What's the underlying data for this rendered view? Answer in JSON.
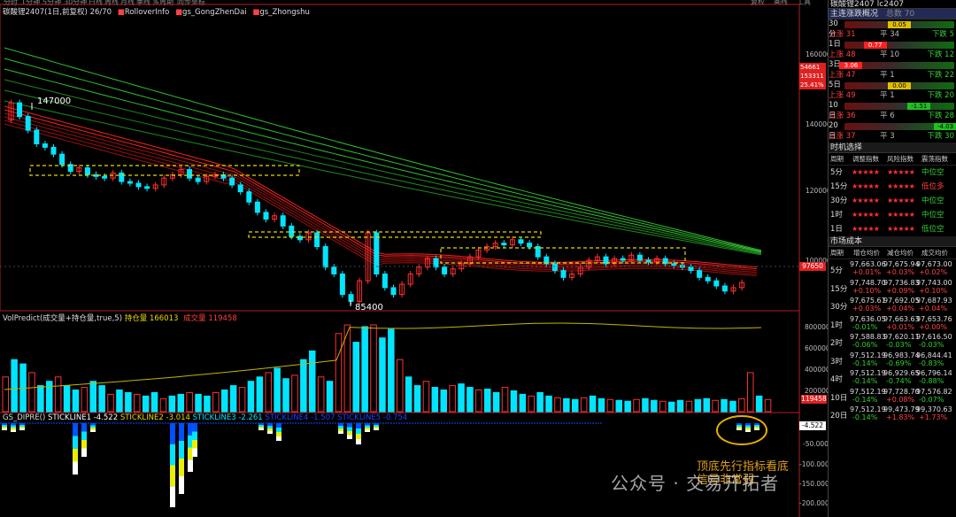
{
  "toolbar": {
    "items": [
      "分时",
      "1分钟",
      "5分钟",
      "30分钟",
      "日线",
      "周线",
      "月线",
      "季线",
      "多周期",
      "同步坐标"
    ],
    "right": [
      "复权",
      "画线",
      "工具"
    ]
  },
  "main_legend": {
    "symbol": "碳酸锂2407(1日,前复权) 26/70",
    "items": [
      "RolloverInfo",
      "gs_GongZhenDai",
      "gs_Zhongshu"
    ]
  },
  "price_axis": {
    "ticks": [
      "160000",
      "140000",
      "120000",
      "100000"
    ],
    "current": "97650",
    "box": [
      "54661",
      "153311",
      "25.41%"
    ]
  },
  "annotations": {
    "high": "147000",
    "low": "85400"
  },
  "vol_legend": {
    "name": "VolPredict(成交量+持仓量,true,5)",
    "oi_label": "持仓量",
    "oi_value": "166013",
    "vol_label": "成交量",
    "vol_value": "119458"
  },
  "vol_axis": {
    "ticks": [
      "800000",
      "600000",
      "400000",
      "200000"
    ],
    "current": "119458"
  },
  "dip_legend": {
    "name": "GS_DIPRE()",
    "l1_label": "STICKLINE1",
    "l1": "-4.522",
    "l2_label": "STICKLINE2",
    "l2": "-3.014",
    "l3_label": "STICKLINE3",
    "l3": "-2.261",
    "l4": "STICKLINE4 -1.507 STICKLINE5 -0.754"
  },
  "dip_axis": {
    "ticks": [
      "-50.000",
      "-100.000",
      "-150.000",
      "-200.000"
    ],
    "current": "-4.522"
  },
  "overlay": {
    "note_line1": "顶底先行指标看底",
    "note_line2": "信号非常弱",
    "watermark": "公众号 · 交易开拓者"
  },
  "panel": {
    "title": "碳酸锂2407 lc2407",
    "section1_title": "主连涨跌概况",
    "section1_extra": "总数 70",
    "rows": [
      {
        "period": "30分",
        "value": "0.05",
        "pos": 50,
        "color": "#e0c000",
        "up": "上涨 31",
        "flat": "平 34",
        "down": "下跌 5"
      },
      {
        "period": "1日",
        "value": "0.77",
        "pos": 28,
        "color": "#ff2020",
        "up": "上涨 48",
        "flat": "平 10",
        "down": "下跌 12"
      },
      {
        "period": "3日",
        "value": "3.06",
        "pos": 6,
        "color": "#ff2020",
        "up": "上涨 47",
        "flat": "平 1",
        "down": "下跌 22"
      },
      {
        "period": "5日",
        "value": "0.00",
        "pos": 50,
        "color": "#e0c000",
        "up": "上涨 49",
        "flat": "平 1",
        "down": "下跌 20"
      },
      {
        "period": "10日",
        "value": "-1.51",
        "pos": 68,
        "color": "#20c020",
        "up": "上涨 36",
        "flat": "平 6",
        "down": "下跌 28"
      },
      {
        "period": "20日",
        "value": "-4.03",
        "pos": 92,
        "color": "#20c020",
        "up": "上涨 37",
        "flat": "平 3",
        "down": "下跌 30"
      }
    ],
    "section2_title": "时机选择",
    "sel_headers": [
      "周期",
      "调整指数",
      "风险指数",
      "震荡指数"
    ],
    "sel_rows": [
      {
        "period": "5分",
        "s1": "★★★★★",
        "s2": "★★★★★",
        "state": "中位空",
        "cls": "dn"
      },
      {
        "period": "15分",
        "s1": "★★★★★",
        "s2": "★★★★★",
        "state": "低位多",
        "cls": "up"
      },
      {
        "period": "30分",
        "s1": "★★★★★",
        "s2": "★★★★★",
        "state": "中位空",
        "cls": "dn"
      },
      {
        "period": "1时",
        "s1": "★★★★★",
        "s2": "★★★★★",
        "state": "中位空",
        "cls": "dn"
      },
      {
        "period": "1日",
        "s1": "★★★★★",
        "s2": "★★★★★",
        "state": "低位空",
        "cls": "dn"
      }
    ],
    "section3_title": "市场成本",
    "cost_headers": [
      "周期",
      "增仓均价",
      "减仓均价",
      "成交均价"
    ],
    "cost_rows": [
      {
        "period": "5分",
        "p": [
          "97,663.06",
          "97,675.94",
          "97,673.00"
        ],
        "c": [
          "+0.01%",
          "+0.03%",
          "+0.02%"
        ],
        "cc": [
          "up",
          "up",
          "up"
        ]
      },
      {
        "period": "15分",
        "p": [
          "97,748.70",
          "97,736.83",
          "97,743.00"
        ],
        "c": [
          "+0.10%",
          "+0.09%",
          "+0.10%"
        ],
        "cc": [
          "up",
          "up",
          "up"
        ]
      },
      {
        "period": "30分",
        "p": [
          "97,675.61",
          "97,692.05",
          "97,687.93"
        ],
        "c": [
          "+0.03%",
          "+0.04%",
          "+0.04%"
        ],
        "cc": [
          "up",
          "up",
          "up"
        ]
      },
      {
        "period": "1时",
        "p": [
          "97,636.05",
          "97,663.63",
          "97,653.76"
        ],
        "c": [
          "-0.01%",
          "+0.01%",
          "+0.00%"
        ],
        "cc": [
          "dn",
          "up",
          "up"
        ]
      },
      {
        "period": "2时",
        "p": [
          "97,588.83",
          "97,620.11",
          "97,616.50"
        ],
        "c": [
          "-0.06%",
          "-0.03%",
          "-0.03%"
        ],
        "cc": [
          "dn",
          "dn",
          "dn"
        ]
      },
      {
        "period": "3时",
        "p": [
          "97,512.19",
          "96,983.74",
          "96,844.41"
        ],
        "c": [
          "-0.14%",
          "-0.69%",
          "-0.83%"
        ],
        "cc": [
          "dn",
          "dn",
          "dn"
        ]
      },
      {
        "period": "4时",
        "p": [
          "97,512.19",
          "96,929.65",
          "96,796.14"
        ],
        "c": [
          "-0.14%",
          "-0.74%",
          "-0.88%"
        ],
        "cc": [
          "dn",
          "dn",
          "dn"
        ]
      },
      {
        "period": "10日",
        "p": [
          "97,512.19",
          "97,728.70",
          "97,576.82"
        ],
        "c": [
          "-0.14%",
          "+0.08%",
          "-0.07%"
        ],
        "cc": [
          "dn",
          "up",
          "dn"
        ]
      },
      {
        "period": "20日",
        "p": [
          "97,512.19",
          "99,473.79",
          "99,370.63"
        ],
        "c": [
          "-0.14%",
          "+1.83%",
          "+1.73%"
        ],
        "cc": [
          "dn",
          "up",
          "up"
        ]
      }
    ]
  },
  "colors": {
    "up": "#ff3030",
    "down": "#00e5ff",
    "ma_red": "#d01010",
    "ma_green": "#20c020",
    "box": "#e8d800"
  }
}
